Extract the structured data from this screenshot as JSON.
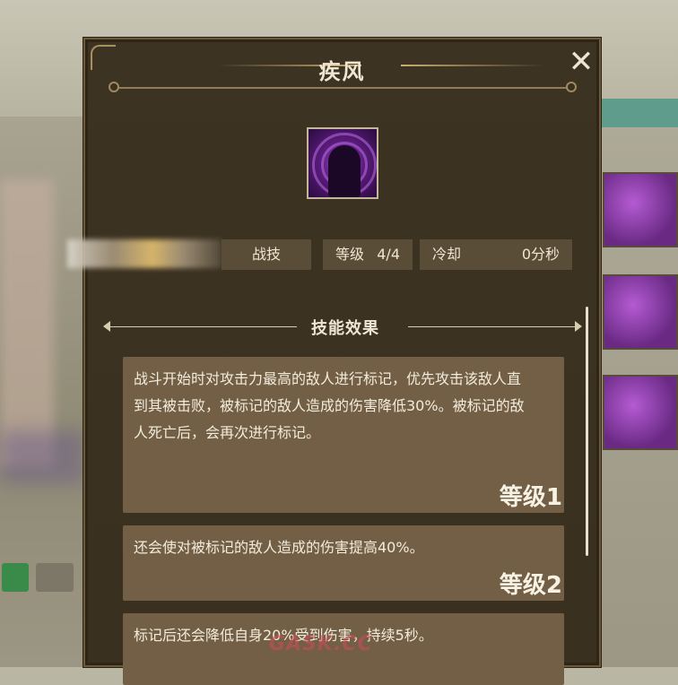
{
  "dialog": {
    "title": "疾风",
    "close_icon": "close-x-icon",
    "skill_icon": "purple-silhouette-skill-icon"
  },
  "stats": {
    "type_label": "战技",
    "level_label": "等级",
    "level_value": "4/4",
    "cooldown_label": "冷却",
    "cooldown_value": "0分秒"
  },
  "effects": {
    "heading": "技能效果",
    "entries": [
      {
        "desc": "战斗开始时对攻击力最高的敌人进行标记，优先攻击该敌人直到其被击败，被标记的敌人造成的伤害降低30%。被标记的敌人死亡后，会再次进行标记。",
        "level": "等级1"
      },
      {
        "desc": "还会使对被标记的敌人造成的伤害提高40%。",
        "level": "等级2"
      },
      {
        "desc": "标记后还会降低自身20%受到伤害，持续5秒。",
        "level": ""
      }
    ]
  },
  "watermark": "GASK.CC"
}
